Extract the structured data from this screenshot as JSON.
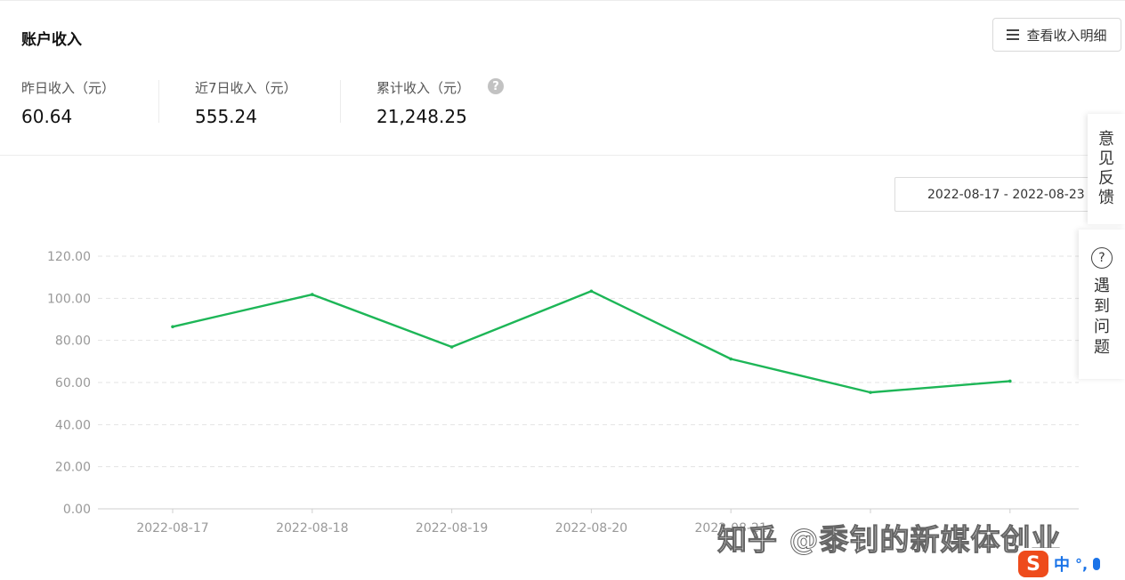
{
  "header": {
    "title": "账户收入",
    "detail_button": "查看收入明细",
    "menu_icon": "menu-icon"
  },
  "stats": [
    {
      "label": "昨日收入（元）",
      "value": "60.64"
    },
    {
      "label": "近7日收入（元）",
      "value": "555.24"
    },
    {
      "label": "累计收入（元）",
      "value": "21,248.25"
    }
  ],
  "help_icon": "question-circle-icon",
  "date_range": "2022-08-17 - 2022-08-23",
  "side_panel": {
    "feedback": [
      "意",
      "见",
      "反",
      "馈"
    ],
    "help": [
      "遇",
      "到",
      "问",
      "题"
    ]
  },
  "chart_data": {
    "type": "line",
    "x": [
      "2022-08-17",
      "2022-08-18",
      "2022-08-19",
      "2022-08-20",
      "2022-08-21",
      "2022-08-22",
      "2022-08-23"
    ],
    "x_tick_labels": [
      "2022-08-17",
      "2022-08-18",
      "2022-08-19",
      "2022-08-20",
      "2022-08-21",
      "",
      ""
    ],
    "series": [
      {
        "values": [
          86.5,
          101.8,
          76.9,
          103.4,
          71.2,
          55.3,
          60.64
        ],
        "color": "#1db657"
      }
    ],
    "y_ticks": [
      "120.00",
      "100.00",
      "80.00",
      "60.00",
      "40.00",
      "20.00",
      "0.00"
    ],
    "ylim": [
      0,
      120
    ],
    "grid": true
  },
  "watermark": "知乎 @黍钊的新媒体创业",
  "ime": {
    "logo": "S",
    "mode": "中",
    "punct": "°,"
  }
}
